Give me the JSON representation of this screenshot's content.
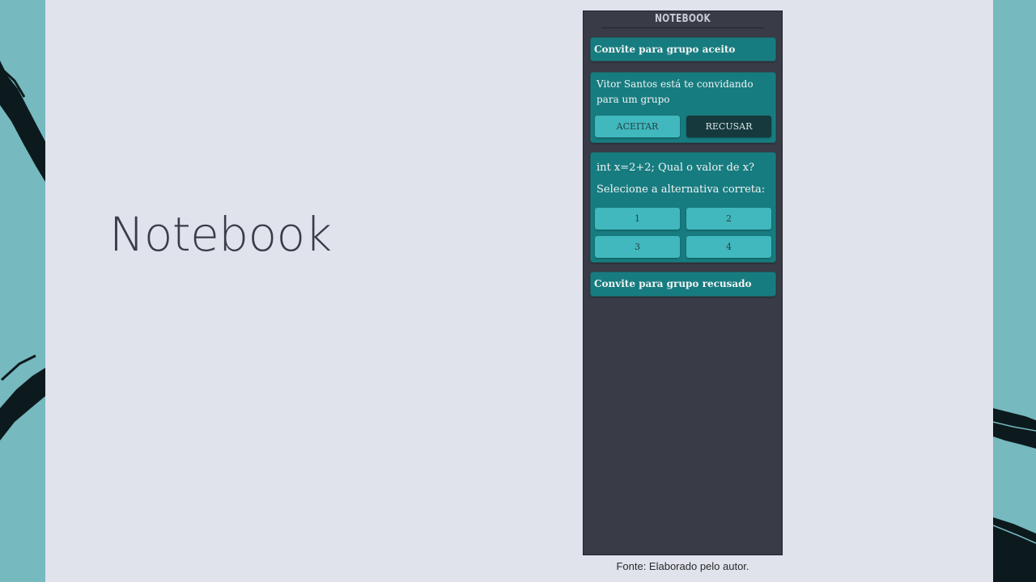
{
  "slide": {
    "title": "Notebook",
    "caption": "Fonte: Elaborado pelo autor."
  },
  "app": {
    "header": "NOTEBOOK",
    "notifications": [
      {
        "text": "Convite para grupo aceito"
      },
      {
        "text": "Convite para grupo recusado"
      }
    ],
    "invite": {
      "message": "Vitor Santos está te convidando para um grupo",
      "accept_label": "ACEITAR",
      "decline_label": "RECUSAR"
    },
    "quiz": {
      "question": "int x=2+2; Qual o valor de x?",
      "prompt": "Selecione a alternativa correta:",
      "options": [
        "1",
        "2",
        "3",
        "4"
      ]
    }
  },
  "colors": {
    "background_accent": "#76b9bf",
    "slide_bg": "#e0e3ec",
    "phone_bg": "#393c47",
    "card_bg": "#177c80",
    "button_light": "#40b8bd",
    "button_dark": "#15393d"
  }
}
